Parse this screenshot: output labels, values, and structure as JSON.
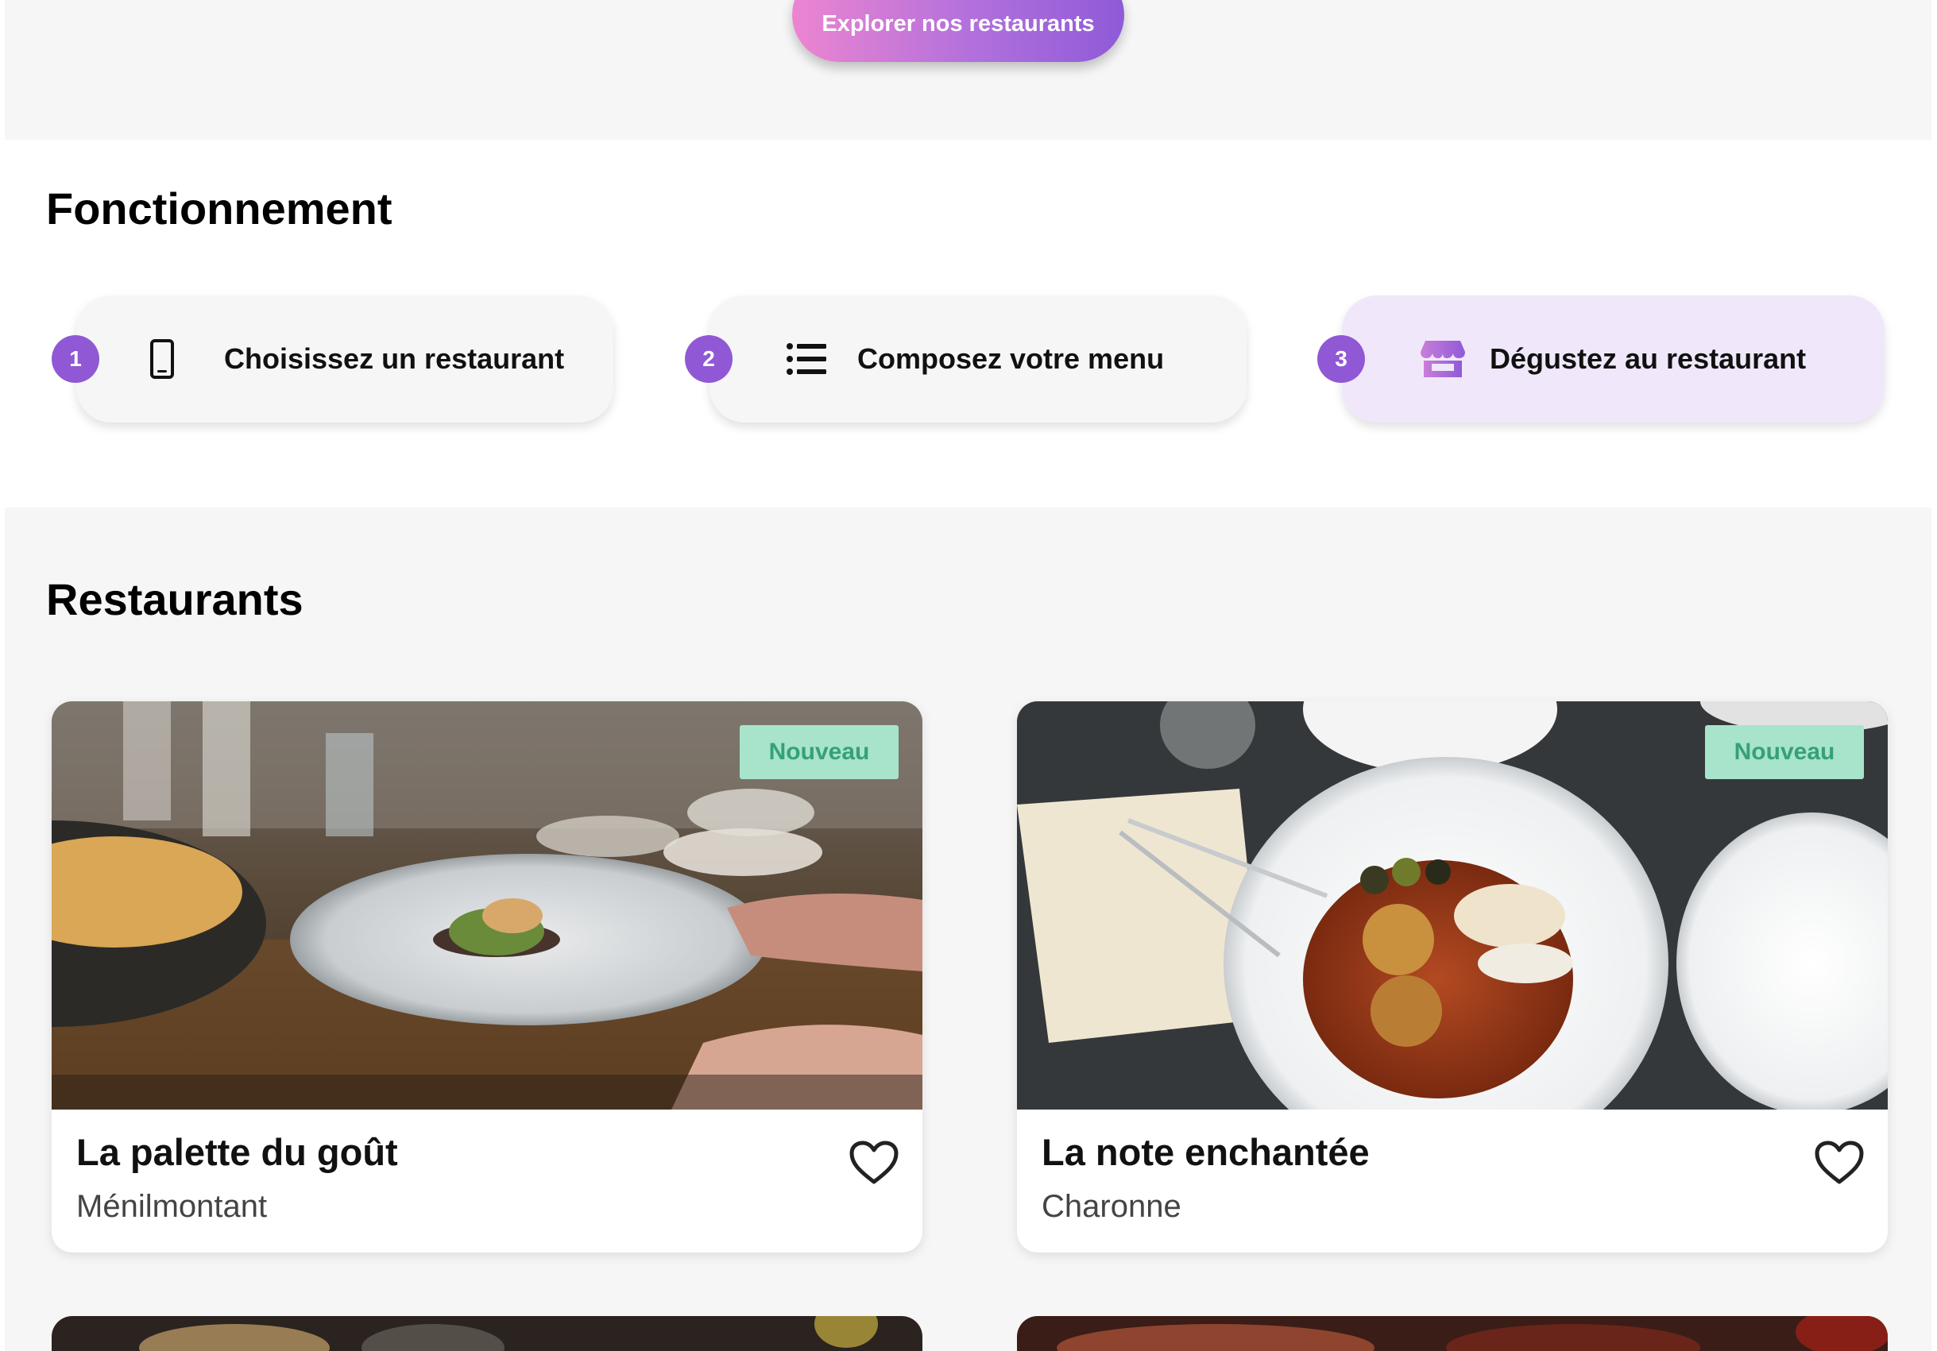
{
  "hero": {
    "cta_label": "Explorer nos restaurants"
  },
  "how_it_works": {
    "title": "Fonctionnement",
    "steps": [
      {
        "number": "1",
        "icon": "smartphone-icon",
        "label": "Choisissez un restaurant"
      },
      {
        "number": "2",
        "icon": "list-icon",
        "label": "Composez votre menu"
      },
      {
        "number": "3",
        "icon": "storefront-icon",
        "label": "Dégustez au restaurant"
      }
    ]
  },
  "restaurants": {
    "title": "Restaurants",
    "items": [
      {
        "name": "La palette du goût",
        "area": "Ménilmontant",
        "badge": "Nouveau",
        "favorite": false
      },
      {
        "name": "La note enchantée",
        "area": "Charonne",
        "badge": "Nouveau",
        "favorite": false
      }
    ]
  },
  "colors": {
    "accent": "#9058d4",
    "cta_gradient_start": "#ec85d0",
    "cta_gradient_end": "#8f5ad8",
    "badge_bg": "#a7e4cb",
    "badge_text": "#36a07a",
    "active_step_bg": "#f0e8fa",
    "section_bg": "#f6f6f6"
  }
}
